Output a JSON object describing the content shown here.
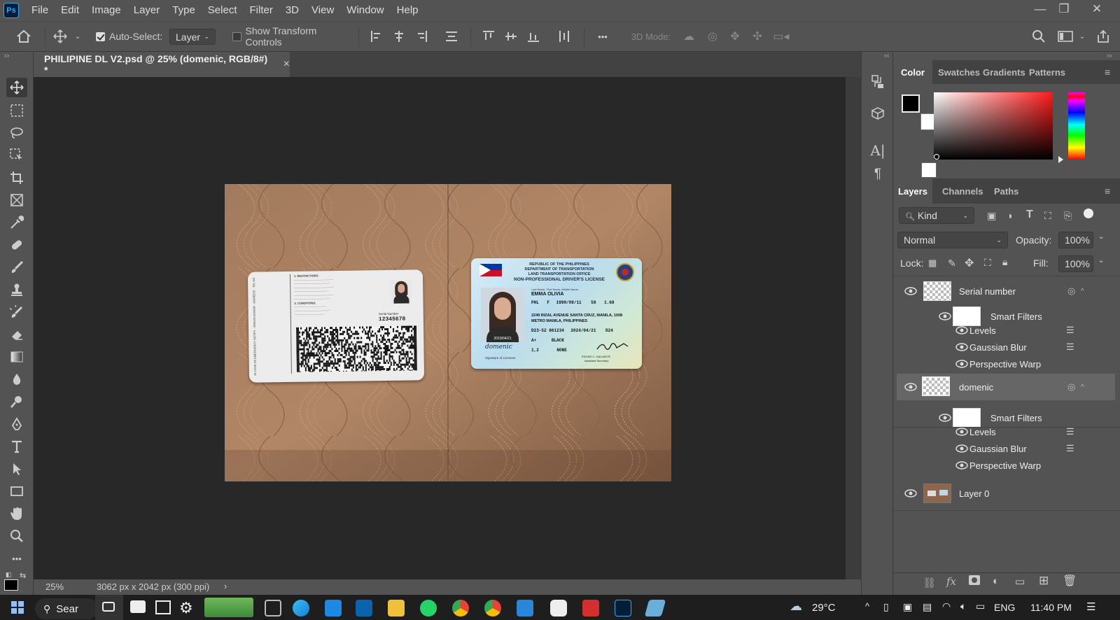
{
  "app": {
    "logo": "Ps"
  },
  "menu": [
    "File",
    "Edit",
    "Image",
    "Layer",
    "Type",
    "Select",
    "Filter",
    "3D",
    "View",
    "Window",
    "Help"
  ],
  "window_controls": {
    "minimize": "—",
    "restore": "❐",
    "close": "✕"
  },
  "options": {
    "auto_select_label": "Auto-Select:",
    "auto_select_value": "Layer",
    "show_transform_label": "Show Transform Controls",
    "more_label": "•••",
    "mode_3d_label": "3D Mode:"
  },
  "document_tab": {
    "title": "PHILIPINE DL V2.psd @ 25% (domenic, RGB/8#) *",
    "close": "×"
  },
  "status": {
    "zoom": "25%",
    "doc_info": "3062 px x 2042 px (300 ppi)",
    "arrow": "›"
  },
  "color_panel": {
    "tabs": [
      "Color",
      "Swatches",
      "Gradients",
      "Patterns"
    ],
    "foreground": "#000000",
    "background": "#ffffff"
  },
  "layers_panel": {
    "tabs": [
      "Layers",
      "Channels",
      "Paths"
    ],
    "filter_kind": "Kind",
    "blend_mode": "Normal",
    "opacity_label": "Opacity:",
    "opacity_value": "100%",
    "lock_label": "Lock:",
    "fill_label": "Fill:",
    "fill_value": "100%",
    "layers": [
      {
        "name": "Serial number"
      },
      {
        "name": "Smart Filters"
      },
      {
        "name": "Levels"
      },
      {
        "name": "Gaussian Blur"
      },
      {
        "name": "Perspective Warp"
      },
      {
        "name": "domenic"
      },
      {
        "name": "Smart Filters"
      },
      {
        "name": "Levels"
      },
      {
        "name": "Gaussian Blur"
      },
      {
        "name": "Perspective Warp"
      },
      {
        "name": "Layer 0"
      }
    ]
  },
  "card_back": {
    "serial_label": "Serial Number",
    "serial_value": "12345678",
    "restrictions_title": "1. RESTRICTIONS:",
    "conditions_title": "2. CONDITIONS:"
  },
  "card_front": {
    "republic": "REPUBLIC OF THE PHILIPPINES",
    "department": "DEPARTMENT OF TRANSPORTATION",
    "office": "LAND TRANSPORTATION OFFICE",
    "license_type": "NON-PROFESSIONAL DRIVER'S LICENSE",
    "name_label": "Last Name, First Name, Middle Name",
    "name": "EMMA OLIVIA",
    "nationality": "PHL",
    "sex": "F",
    "dob": "1990/09/11",
    "weight": "58",
    "height": "1.68",
    "address": "2249 RIZAL AVENUE SANTA CRUZ, MANILA, 1008",
    "address2": "METRO MANILA, PHILIPPINES",
    "license_no": "D23-52 861234",
    "expiry": "2024/04/21",
    "agency": "D24",
    "blood": "A+",
    "eyes": "BLACK",
    "restrictions": "1,2",
    "conditions": "NONE",
    "date_under_photo": "2019/04/21",
    "signature": "domenic",
    "signature_label": "Signature of Licensee",
    "official": "EDGAR C. GALVANTE",
    "official_title": "Assistant Secretary"
  },
  "taskbar": {
    "search": "Sear",
    "weather": "29°C",
    "lang": "ENG",
    "time": "11:40 PM"
  }
}
